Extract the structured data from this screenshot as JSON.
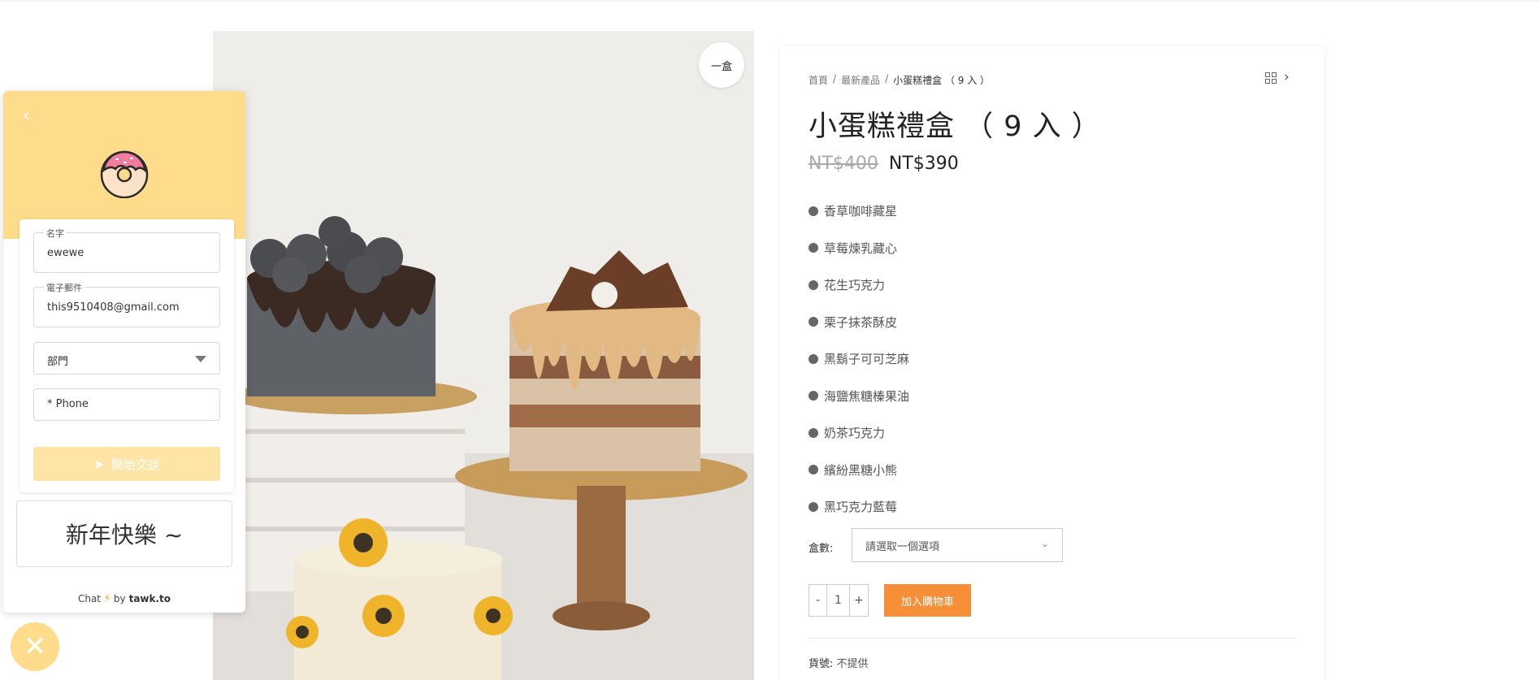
{
  "badge": {
    "text": "一盒"
  },
  "chat": {
    "back_icon": "chevron-left-icon",
    "logo_icon": "donut-icon",
    "name_field": {
      "legend": "名字",
      "value": "ewewe"
    },
    "email_field": {
      "legend": "電子郵件",
      "value": "this9510408@gmail.com"
    },
    "department_field": {
      "value": "部門"
    },
    "phone_field": {
      "placeholder": "* Phone"
    },
    "start_button": "開始交談",
    "note": "新年快樂 ~",
    "footer": {
      "prefix": "Chat",
      "by": "by",
      "brand": "tawk.to"
    },
    "accent": "#fedc8c"
  },
  "product": {
    "breadcrumbs": [
      "首頁",
      "最新產品",
      "小蛋糕禮盒 （ 9 入 ）"
    ],
    "breadcrumb_sep": "/",
    "title": "小蛋糕禮盒 （ 9 入 ）",
    "price_old": "NT$400",
    "price_new": "NT$390",
    "flavors": [
      "香草咖啡藏星",
      "草莓煉乳藏心",
      "花生巧克力",
      "栗子抹茶酥皮",
      "黑鬍子可可芝麻",
      "海鹽焦糖榛果油",
      "奶茶巧克力",
      "繽紛黑糖小熊",
      "黑巧克力藍莓"
    ],
    "qty_label": "盒數:",
    "select_placeholder": "請選取一個選項",
    "quantity": "1",
    "minus": "-",
    "plus": "+",
    "add_to_cart": "加入購物車",
    "sku_label": "貨號:",
    "sku_value": "不提供",
    "cart_color": "#f68f38"
  }
}
